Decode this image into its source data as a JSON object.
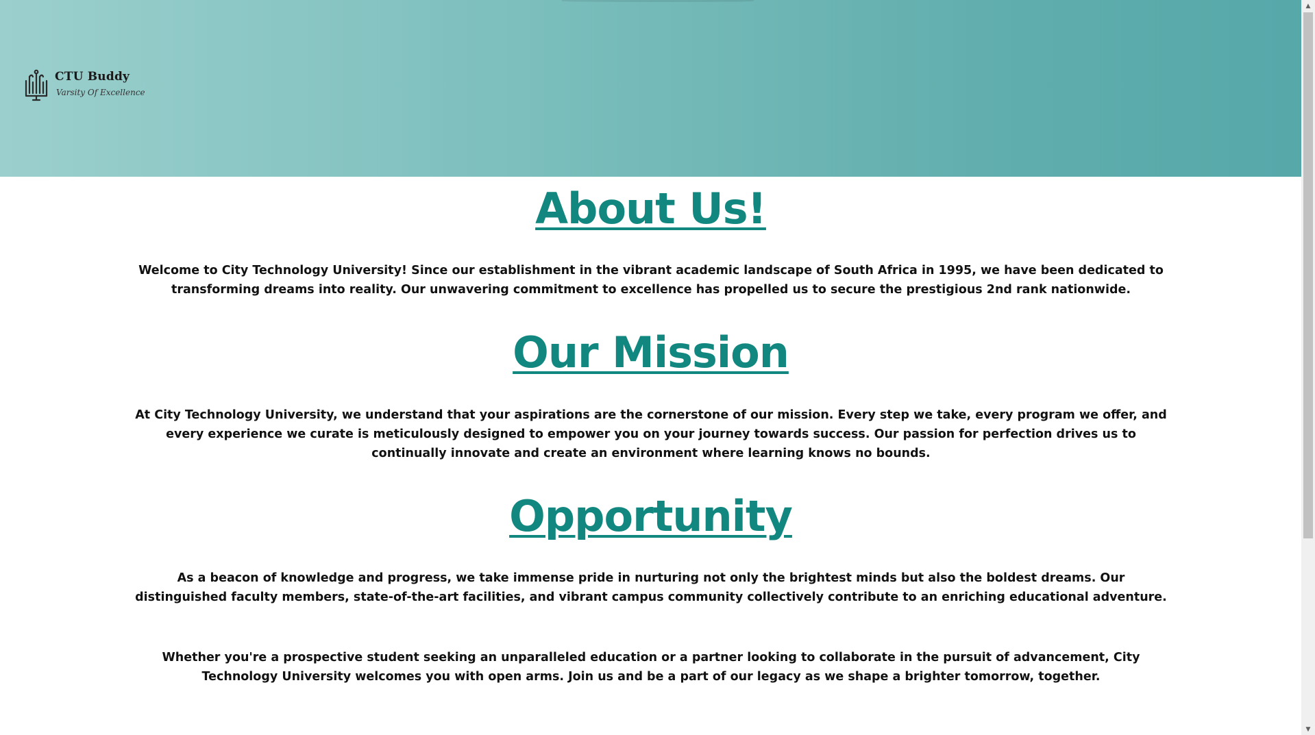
{
  "header": {
    "brand_name": "CTU Buddy",
    "tagline": "Varsity Of Excellence",
    "logo_icon": "university-book-icon"
  },
  "sections": [
    {
      "title": "About Us!",
      "paragraphs": [
        "Welcome to City Technology University! Since our establishment in the vibrant academic landscape of South Africa in 1995, we have been dedicated to transforming dreams into reality. Our unwavering commitment to excellence has propelled us to secure the prestigious 2nd rank nationwide."
      ]
    },
    {
      "title": "Our Mission",
      "paragraphs": [
        "At City Technology University, we understand that your aspirations are the cornerstone of our mission. Every step we take, every program we offer, and every experience we curate is meticulously designed to empower you on your journey towards success. Our passion for perfection drives us to continually innovate and create an environment where learning knows no bounds."
      ]
    },
    {
      "title": "Opportunity",
      "paragraphs": [
        "As a beacon of knowledge and progress, we take immense pride in nurturing not only the brightest minds but also the boldest dreams. Our distinguished faculty members, state-of-the-art facilities, and vibrant campus community collectively contribute to an enriching educational adventure.",
        "Whether you're a prospective student seeking an unparalleled education or a partner looking to collaborate in the pursuit of advancement, City Technology University welcomes you with open arms. Join us and be a part of our legacy as we shape a brighter tomorrow, together."
      ]
    }
  ],
  "scrollbar": {
    "up_icon": "scroll-up-arrow-icon",
    "down_icon": "scroll-down-arrow-icon"
  },
  "colors": {
    "heading": "#128780",
    "header_gradient_start": "#9bcfcd",
    "header_gradient_end": "#56a8a9",
    "body_text": "#111111"
  }
}
